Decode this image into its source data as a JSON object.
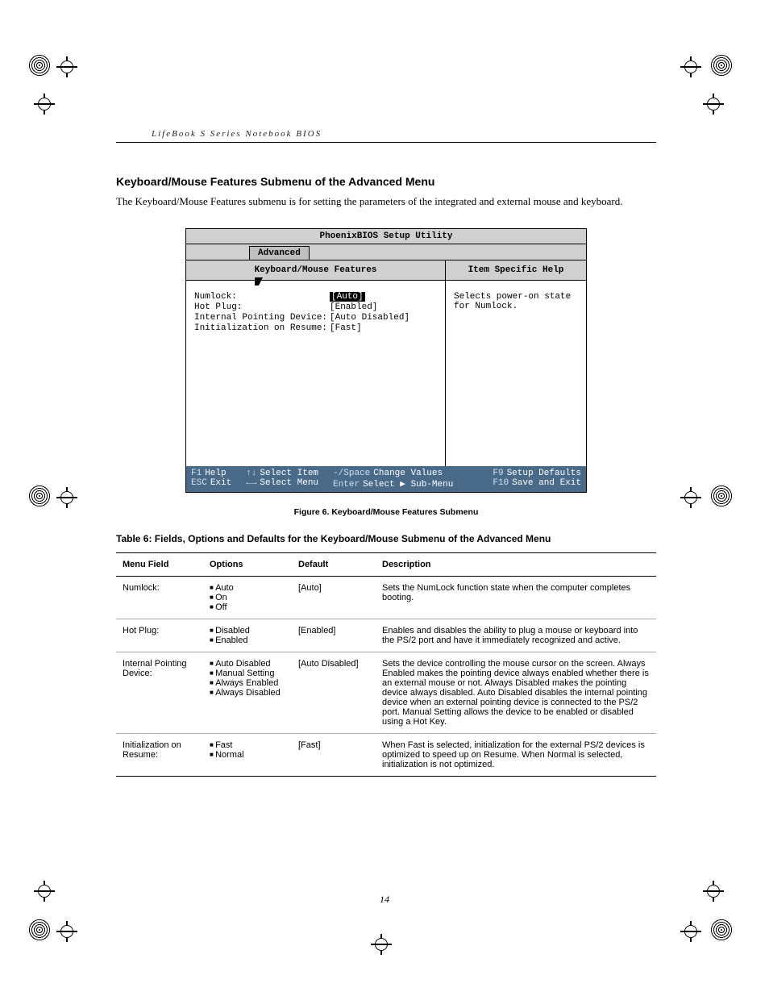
{
  "running_head": "LifeBook S Series Notebook BIOS",
  "section_title": "Keyboard/Mouse Features Submenu of the Advanced Menu",
  "intro": "The Keyboard/Mouse Features submenu is for setting the parameters of the integrated and external mouse and keyboard.",
  "bios": {
    "title": "PhoenixBIOS Setup Utility",
    "tab": "Advanced",
    "left_header": "Keyboard/Mouse Features",
    "right_header": "Item Specific Help",
    "rows": [
      {
        "label": "Numlock:",
        "value": "[Auto]",
        "highlighted": true
      },
      {
        "label": "Hot Plug:",
        "value": "[Enabled]"
      },
      {
        "label": "Internal Pointing Device:",
        "value": "[Auto Disabled]"
      },
      {
        "label": "Initialization on Resume:",
        "value": "[Fast]"
      }
    ],
    "help_text": "Selects power-on state for Numlock.",
    "footer": {
      "f1": "F1",
      "f1_label": "Help",
      "esc": "ESC",
      "esc_label": "Exit",
      "updown": "↑↓",
      "updown_label": "Select Item",
      "leftright": "←→",
      "leftright_label": "Select Menu",
      "minus": "-/Space",
      "minus_label": "Change Values",
      "enter": "Enter",
      "enter_label": "Select ▶ Sub-Menu",
      "f9": "F9",
      "f9_label": "Setup Defaults",
      "f10": "F10",
      "f10_label": "Save and Exit"
    }
  },
  "figure_caption": "Figure 6.  Keyboard/Mouse Features Submenu",
  "table_caption": "Table 6: Fields, Options and Defaults for the Keyboard/Mouse Submenu of the Advanced Menu",
  "table": {
    "headers": [
      "Menu Field",
      "Options",
      "Default",
      "Description"
    ],
    "rows": [
      {
        "field": "Numlock:",
        "options": [
          "Auto",
          "On",
          "Off"
        ],
        "default": "[Auto]",
        "desc": "Sets the NumLock function state when the computer completes booting."
      },
      {
        "field": "Hot Plug:",
        "options": [
          "Disabled",
          "Enabled"
        ],
        "default": "[Enabled]",
        "desc": "Enables and disables the ability to plug a mouse or keyboard into the PS/2 port and have it immediately recognized and active."
      },
      {
        "field": "Internal Pointing Device:",
        "options": [
          "Auto Disabled",
          "Manual Setting",
          "Always Enabled",
          "Always Disabled"
        ],
        "default": "[Auto Disabled]",
        "desc": "Sets the device controlling the mouse cursor on the screen. Always Enabled makes the pointing device always enabled whether there is an external mouse or not. Always Disabled makes the pointing device always disabled. Auto Disabled disables the internal pointing device when an external pointing device is connected to the PS/2 port. Manual Setting allows the device to be enabled or disabled using a Hot Key."
      },
      {
        "field": "Initialization on Resume:",
        "options": [
          "Fast",
          "Normal"
        ],
        "default": "[Fast]",
        "desc": "When Fast is selected, initialization for the external PS/2 devices is optimized to speed up on Resume. When Normal is selected, initialization is not optimized."
      }
    ]
  },
  "page_number": "14"
}
